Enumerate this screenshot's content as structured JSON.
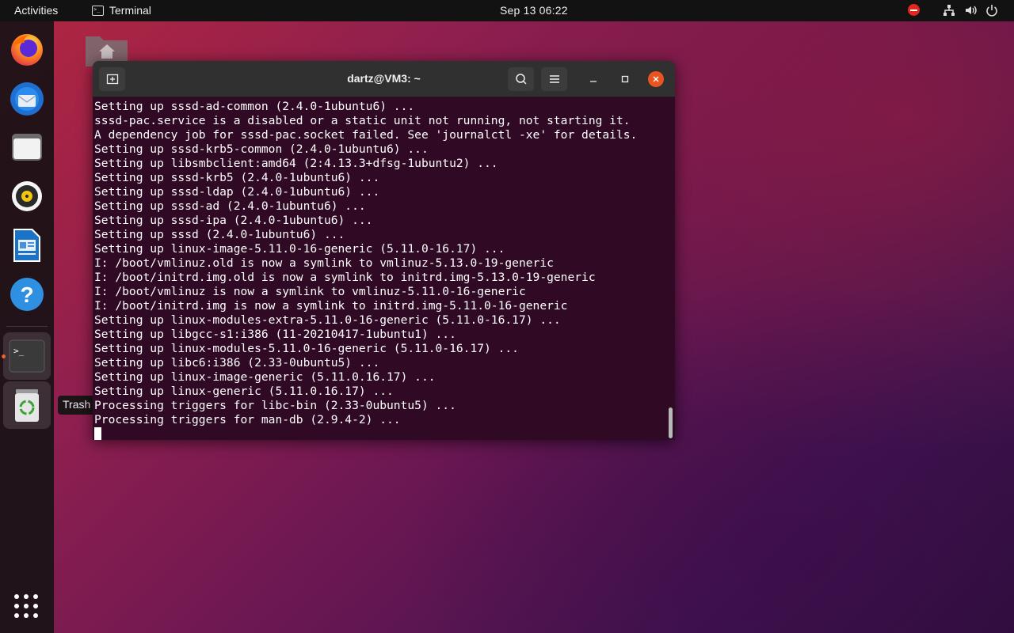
{
  "topbar": {
    "activities": "Activities",
    "app_name": "Terminal",
    "clock": "Sep 13  06:22",
    "status_icons": [
      "do-not-disturb-icon",
      "network-icon",
      "volume-icon",
      "power-icon"
    ]
  },
  "dock": {
    "items": [
      {
        "name": "firefox",
        "icon": "firefox-icon"
      },
      {
        "name": "thunderbird",
        "icon": "thunderbird-icon"
      },
      {
        "name": "files",
        "icon": "files-icon"
      },
      {
        "name": "rhythmbox",
        "icon": "rhythmbox-icon"
      },
      {
        "name": "libreoffice-writer",
        "icon": "writer-icon"
      },
      {
        "name": "help",
        "icon": "help-icon"
      },
      {
        "name": "terminal",
        "icon": "terminal-icon"
      },
      {
        "name": "trash",
        "icon": "trash-icon"
      }
    ],
    "tooltip": "Trash",
    "show_apps_icon": "apps-grid-icon",
    "running_indicator_color": "#e95420"
  },
  "terminal": {
    "title": "dartz@VM3: ~",
    "background": "#300a24",
    "lines": [
      "Setting up sssd-ad-common (2.4.0-1ubuntu6) ...",
      "sssd-pac.service is a disabled or a static unit not running, not starting it.",
      "A dependency job for sssd-pac.socket failed. See 'journalctl -xe' for details.",
      "Setting up sssd-krb5-common (2.4.0-1ubuntu6) ...",
      "Setting up libsmbclient:amd64 (2:4.13.3+dfsg-1ubuntu2) ...",
      "Setting up sssd-krb5 (2.4.0-1ubuntu6) ...",
      "Setting up sssd-ldap (2.4.0-1ubuntu6) ...",
      "Setting up sssd-ad (2.4.0-1ubuntu6) ...",
      "Setting up sssd-ipa (2.4.0-1ubuntu6) ...",
      "Setting up sssd (2.4.0-1ubuntu6) ...",
      "Setting up linux-image-5.11.0-16-generic (5.11.0-16.17) ...",
      "I: /boot/vmlinuz.old is now a symlink to vmlinuz-5.13.0-19-generic",
      "I: /boot/initrd.img.old is now a symlink to initrd.img-5.13.0-19-generic",
      "I: /boot/vmlinuz is now a symlink to vmlinuz-5.11.0-16-generic",
      "I: /boot/initrd.img is now a symlink to initrd.img-5.11.0-16-generic",
      "Setting up linux-modules-extra-5.11.0-16-generic (5.11.0-16.17) ...",
      "Setting up libgcc-s1:i386 (11-20210417-1ubuntu1) ...",
      "Setting up linux-modules-5.11.0-16-generic (5.11.0-16.17) ...",
      "Setting up libc6:i386 (2.33-0ubuntu5) ...",
      "Setting up linux-image-generic (5.11.0.16.17) ...",
      "Setting up linux-generic (5.11.0.16.17) ...",
      "Processing triggers for libc-bin (2.33-0ubuntu5) ...",
      "Processing triggers for man-db (2.9.4-2) ..."
    ]
  }
}
